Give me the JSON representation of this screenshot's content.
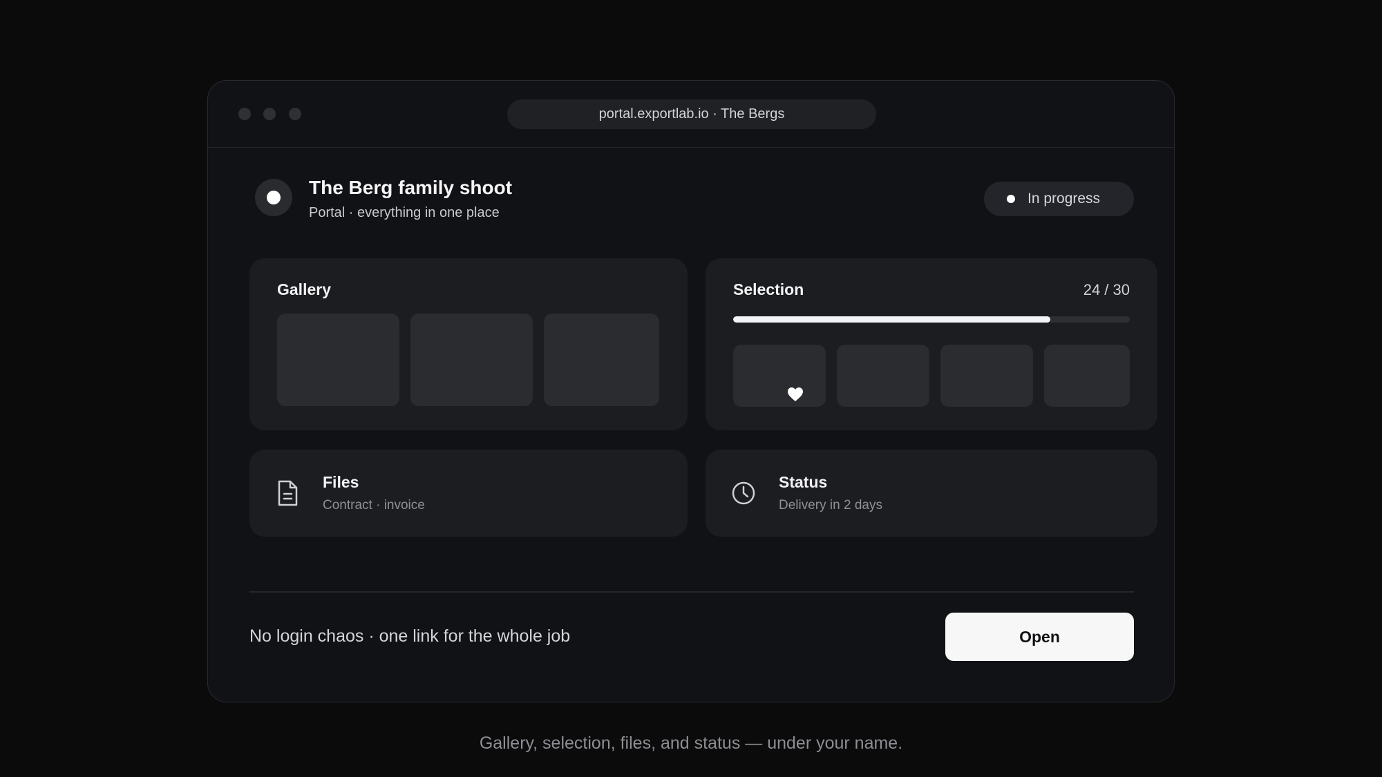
{
  "window": {
    "url": "portal.exportlab.io · The Bergs"
  },
  "header": {
    "title": "The Berg family shoot",
    "subtitle": "Portal · everything in one place",
    "status": "In progress"
  },
  "gallery": {
    "title": "Gallery",
    "thumbnail_count": 3
  },
  "selection": {
    "title": "Selection",
    "count_label": "24 / 30",
    "selected": 24,
    "total": 30,
    "progress_fraction": 0.8,
    "favorite_icon": "heart-icon"
  },
  "files": {
    "title": "Files",
    "subtitle": "Contract · invoice",
    "icon": "document-icon"
  },
  "status_card": {
    "title": "Status",
    "subtitle": "Delivery in 2 days",
    "icon": "clock-icon"
  },
  "footer": {
    "tagline": "No login chaos · one link for the whole job",
    "open_label": "Open"
  },
  "caption": "Gallery, selection, files, and status — under your name.",
  "colors": {
    "background": "#0b0b0c",
    "window": "#111215",
    "card": "#1c1d21",
    "accent": "#f4f4f6"
  }
}
